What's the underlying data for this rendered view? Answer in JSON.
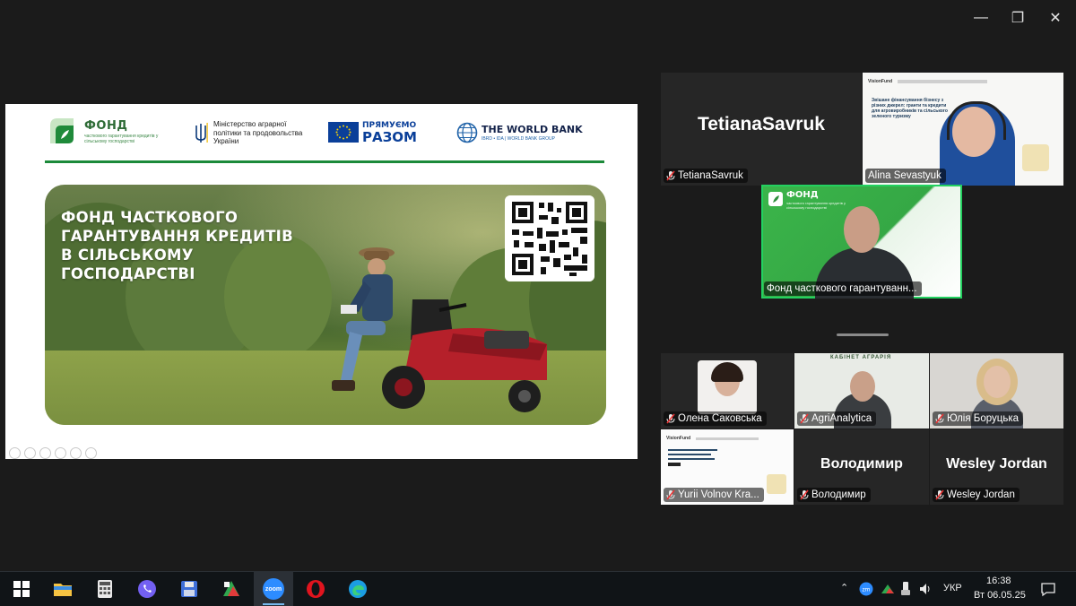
{
  "window": {
    "minimize_glyph": "—",
    "restore_glyph": "❐",
    "close_glyph": "✕"
  },
  "slide": {
    "fond": {
      "title": "ФОНД",
      "subtitle": "часткового гарантування кредитів у сільському господарстві"
    },
    "ministry": "Міністерство аграрної політики та продовольства України",
    "eu": {
      "line1": "ПРЯМУЄМО",
      "line2": "РАЗОМ"
    },
    "world_bank": {
      "title": "THE WORLD BANK",
      "subtitle": "IBRD • IDA | WORLD BANK GROUP"
    },
    "hero_title": "ФОНД ЧАСТКОВОГО ГАРАНТУВАННЯ КРЕДИТІВ В СІЛЬСЬКОМУ ГОСПОДАРСТВІ"
  },
  "participants": {
    "tetiana": {
      "big_name": "TetianaSavruk",
      "tag": "TetianaSavruk"
    },
    "alina": {
      "tag": "Alina Sevastyuk",
      "poster_header": "VisionFund",
      "poster_body": "Звішане фінансування бізнесу з різних джерел: гранти та кредити для агровиробників та сільського зеленого туризму"
    },
    "fond": {
      "brand": "ФОНД",
      "brand_sub": "часткового гарантування кредитів у сільському господарстві",
      "tag": "Фонд часткового гарантуванн..."
    },
    "olena": {
      "tag": "Олена Саковська"
    },
    "agri": {
      "tag": "AgriAnalytica",
      "banner": "КАБІНЕТ АГРАРІЯ"
    },
    "yulia": {
      "tag": "Юлія Боруцька"
    },
    "yurii": {
      "tag": "Yurii Volnov Kra...",
      "poster_header": "VisionFund"
    },
    "volodymyr": {
      "big_name": "Володимир",
      "tag": "Володимир"
    },
    "wesley": {
      "big_name": "Wesley Jordan",
      "tag": "Wesley Jordan"
    }
  },
  "taskbar": {
    "zoom_label": "zoom",
    "tray_chevron": "⌃",
    "language": "УКР",
    "time": "16:38",
    "date": "Вт 06.05.25"
  }
}
